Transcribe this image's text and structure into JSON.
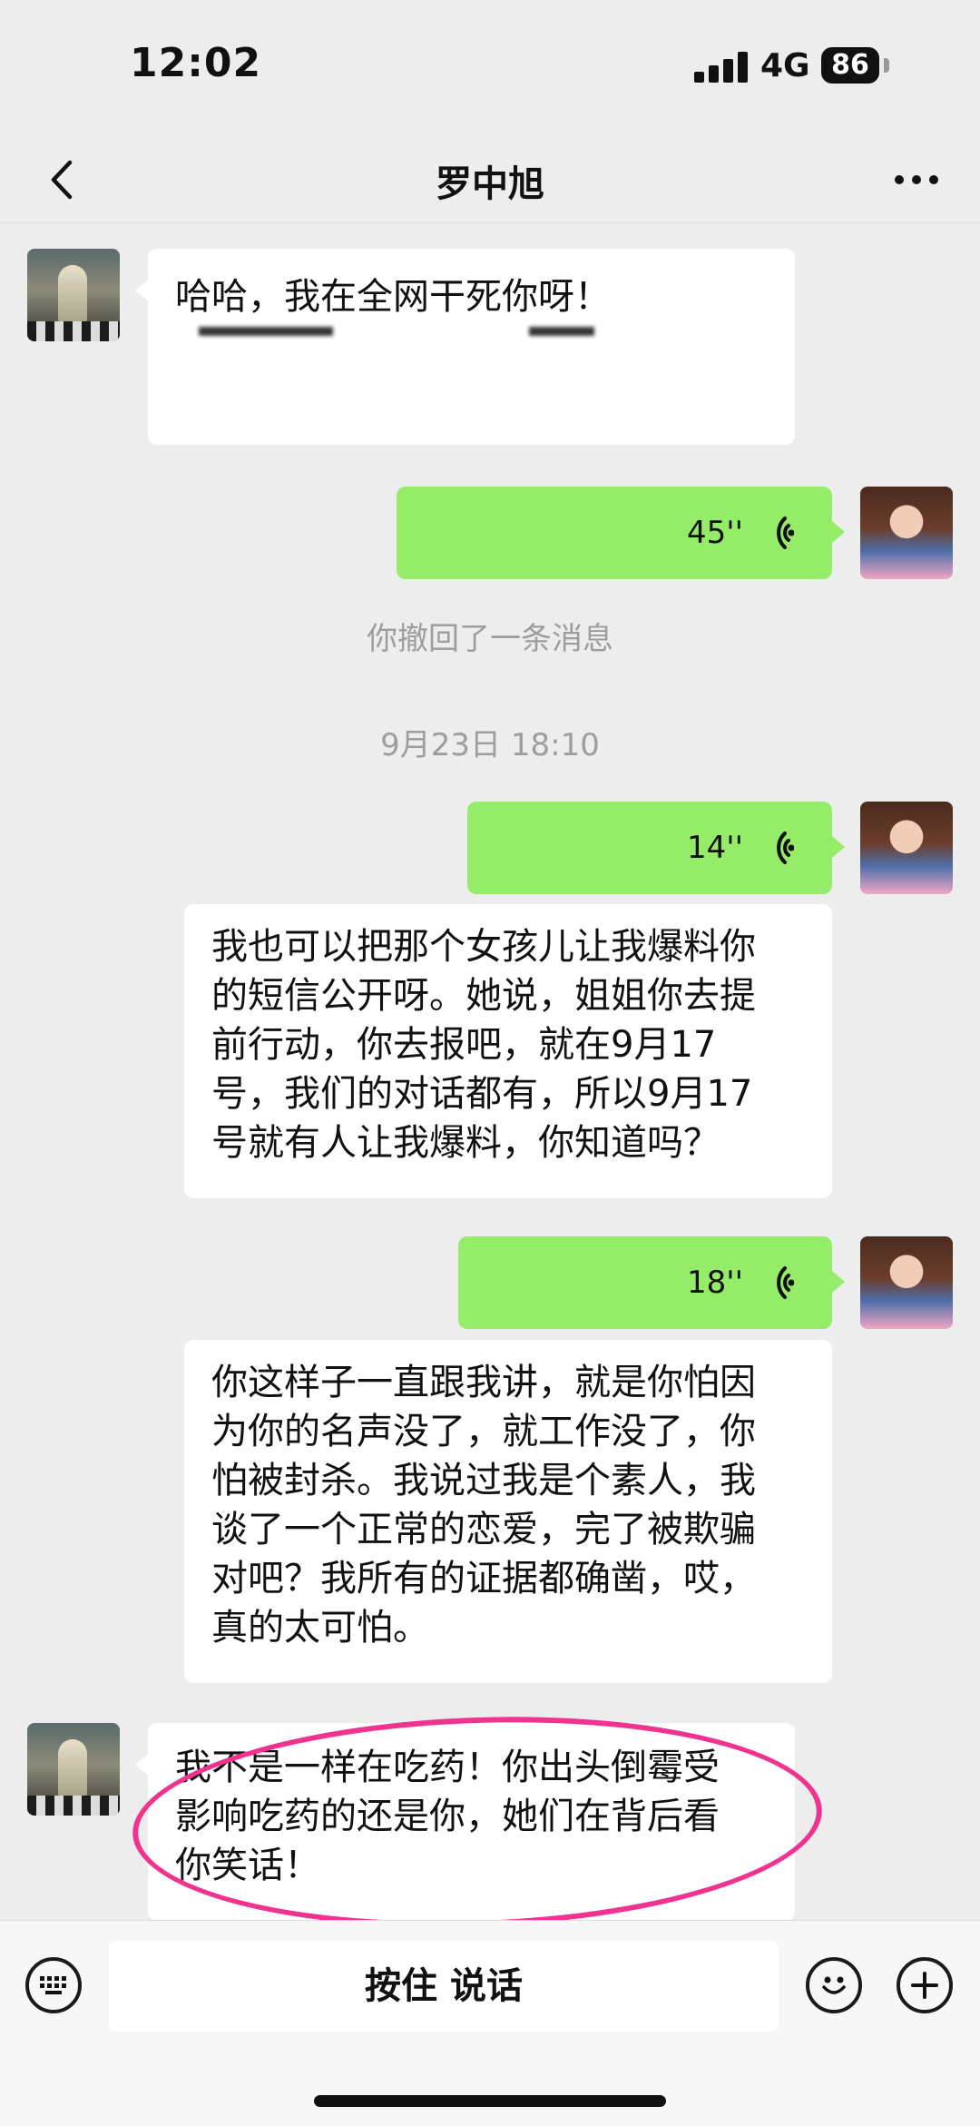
{
  "status": {
    "time": "12:02",
    "network": "4G",
    "battery": "86"
  },
  "header": {
    "title": "罗中旭"
  },
  "messages": {
    "m1": "哈哈，我在全网干死你呀！",
    "v1": "45''",
    "recall": "你撤回了一条消息",
    "timestamp": "9月23日 18:10",
    "v2": "14''",
    "m2": "我也可以把那个女孩儿让我爆料你\n的短信公开呀。她说，姐姐你去提\n前行动，你去报吧，就在9月17\n号，我们的对话都有，所以9月17\n号就有人让我爆料，你知道吗？",
    "v3": "18''",
    "m3": "你这样子一直跟我讲，就是你怕因\n为你的名声没了，就工作没了，你\n怕被封杀。我说过我是个素人，我\n谈了一个正常的恋爱，完了被欺骗\n对吧？我所有的证据都确凿，哎，\n真的太可怕。",
    "m4": "我不是一样在吃药！你出头倒霉受\n影响吃药的还是你，她们在背后看\n你笑话！"
  },
  "input": {
    "talk_label": "按住 说话"
  },
  "icons": {
    "back": "chevron-left-icon",
    "more": "more-dots-icon",
    "keyboard": "keyboard-icon",
    "emoji": "emoji-icon",
    "plus": "plus-icon",
    "voice": "voice-wave-icon"
  },
  "colors": {
    "sent_bubble": "#95ec69",
    "received_bubble": "#ffffff",
    "annotation": "#f0338e"
  }
}
